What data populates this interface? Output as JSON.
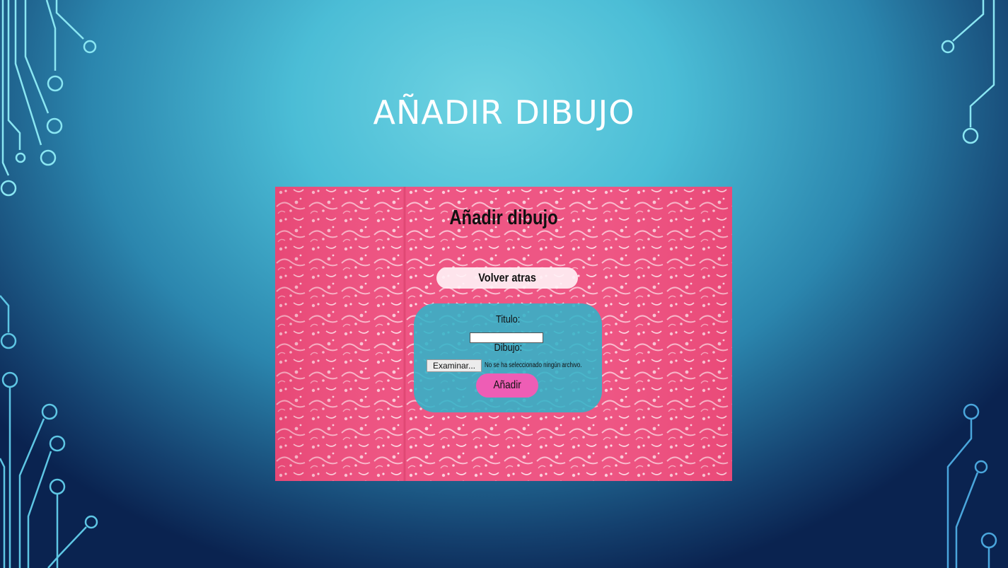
{
  "slide": {
    "title": "AÑADIR DIBUJO"
  },
  "app": {
    "heading": "Añadir dibujo",
    "back_button": "Volver atras",
    "form": {
      "title_label": "Titulo:",
      "title_value": "",
      "drawing_label": "Dibujo:",
      "browse_button": "Examinar...",
      "file_status": "No se ha seleccionado ningún archivo.",
      "submit_button": "Añadir"
    }
  },
  "colors": {
    "background_light": "#6ed3e2",
    "background_dark": "#0a2350",
    "pattern_pink": "#ec4d7d",
    "form_card": "#30b4c8",
    "submit_button": "#ee5db5",
    "circuit_line": "#7fe3f0"
  }
}
